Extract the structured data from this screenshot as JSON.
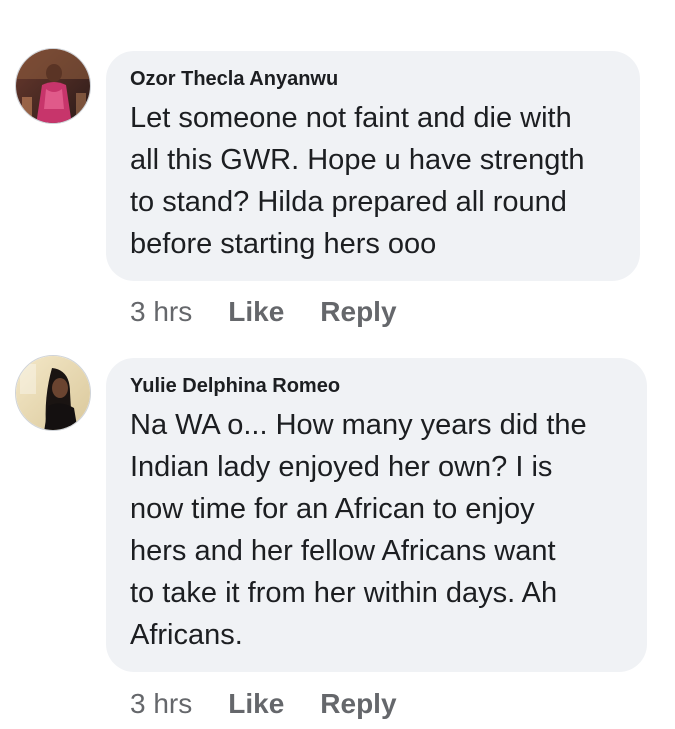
{
  "comments": [
    {
      "author": "Ozor Thecla Anyanwu",
      "text": "Let someone not faint and die with\nall this GWR. Hope u have strength\nto stand? Hilda prepared all round\nbefore starting hers ooo",
      "time": "3 hrs",
      "like_label": "Like",
      "reply_label": "Reply",
      "avatar": "profile-photo-woman-pink-dress"
    },
    {
      "author": "Yulie Delphina Romeo",
      "text": "Na WA o... How many years did the\nIndian lady enjoyed her own? I is\nnow time for an African to enjoy\nhers and her fellow Africans want\nto take it from her within days. Ah\nAfricans.",
      "time": "3 hrs",
      "like_label": "Like",
      "reply_label": "Reply",
      "avatar": "profile-photo-woman-dark-hair"
    }
  ],
  "colors": {
    "bubble_bg": "#f0f2f5",
    "text": "#1c1e21",
    "meta": "#65676b"
  }
}
